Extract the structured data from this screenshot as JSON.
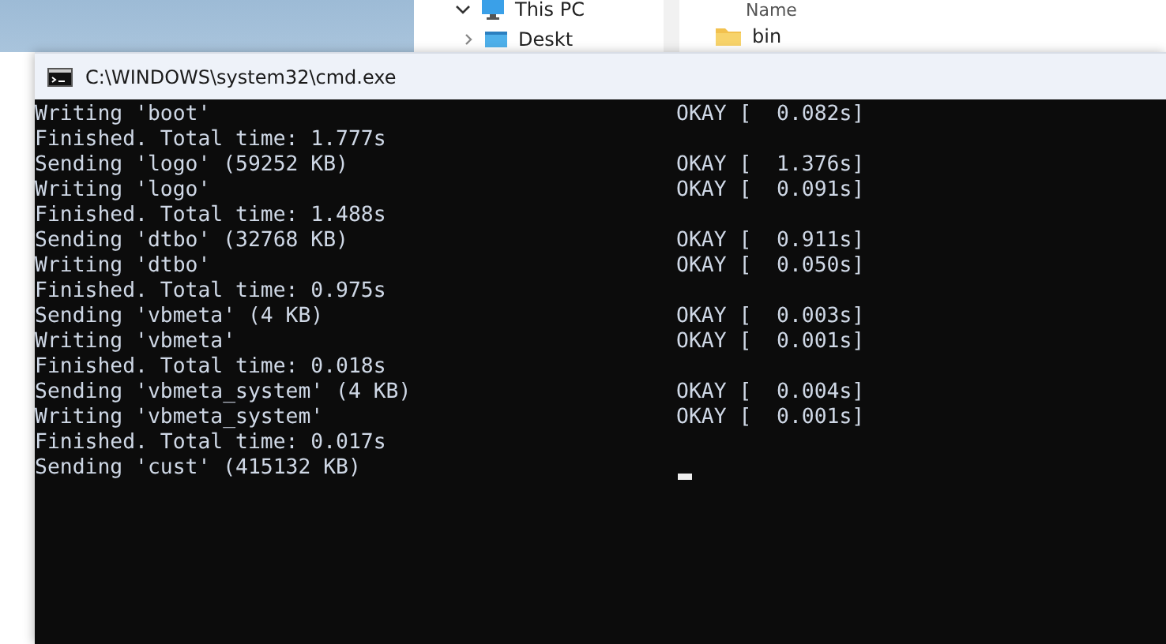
{
  "explorer": {
    "nav_items": [
      {
        "label": "This PC",
        "kind": "pc"
      },
      {
        "label": "Deskt",
        "kind": "desktop"
      }
    ],
    "column_header": "Name",
    "files": [
      {
        "name": "bin"
      }
    ]
  },
  "console": {
    "title": "C:\\WINDOWS\\system32\\cmd.exe",
    "lines": [
      {
        "text": "Writing 'boot'",
        "status": "OKAY [  0.082s]"
      },
      {
        "text": "Finished. Total time: 1.777s"
      },
      {
        "text": "Sending 'logo' (59252 KB)",
        "status": "OKAY [  1.376s]"
      },
      {
        "text": "Writing 'logo'",
        "status": "OKAY [  0.091s]"
      },
      {
        "text": "Finished. Total time: 1.488s"
      },
      {
        "text": "Sending 'dtbo' (32768 KB)",
        "status": "OKAY [  0.911s]"
      },
      {
        "text": "Writing 'dtbo'",
        "status": "OKAY [  0.050s]"
      },
      {
        "text": "Finished. Total time: 0.975s"
      },
      {
        "text": "Sending 'vbmeta' (4 KB)",
        "status": "OKAY [  0.003s]"
      },
      {
        "text": "Writing 'vbmeta'",
        "status": "OKAY [  0.001s]"
      },
      {
        "text": "Finished. Total time: 0.018s"
      },
      {
        "text": "Sending 'vbmeta_system' (4 KB)",
        "status": "OKAY [  0.004s]"
      },
      {
        "text": "Writing 'vbmeta_system'",
        "status": "OKAY [  0.001s]"
      },
      {
        "text": "Finished. Total time: 0.017s"
      },
      {
        "text": "Sending 'cust' (415132 KB)",
        "cursor": true
      }
    ]
  }
}
